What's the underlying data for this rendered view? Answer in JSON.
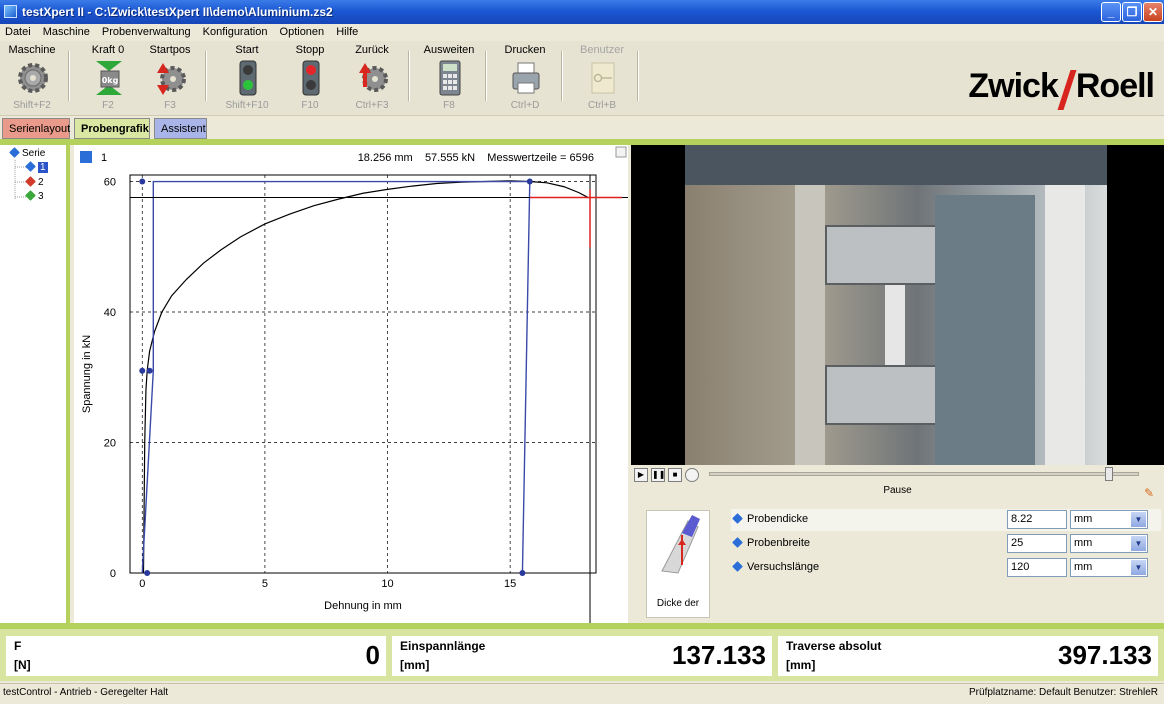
{
  "window": {
    "title": "testXpert II - C:\\Zwick\\testXpert II\\demo\\Aluminium.zs2",
    "controls": [
      "_",
      "❐",
      "✕"
    ]
  },
  "menu": [
    "Datei",
    "Maschine",
    "Probenverwaltung",
    "Konfiguration",
    "Optionen",
    "Hilfe"
  ],
  "toolbar": {
    "buttons": [
      {
        "label": "Maschine",
        "shortcut": "Shift+F2",
        "icon": "gear-icon"
      },
      {
        "label": "Kraft 0",
        "shortcut": "F2",
        "icon": "force-zero-icon"
      },
      {
        "label": "Startpos",
        "shortcut": "F3",
        "icon": "start-position-icon"
      },
      {
        "label": "Start",
        "shortcut": "Shift+F10",
        "icon": "traffic-light-green-icon"
      },
      {
        "label": "Stopp",
        "shortcut": "F10",
        "icon": "traffic-light-red-icon"
      },
      {
        "label": "Zurück",
        "shortcut": "Ctrl+F3",
        "icon": "return-icon"
      },
      {
        "label": "Ausweiten",
        "shortcut": "F8",
        "icon": "calculator-icon"
      },
      {
        "label": "Drucken",
        "shortcut": "Ctrl+D",
        "icon": "printer-icon"
      },
      {
        "label": "Benutzer",
        "shortcut": "Ctrl+B",
        "icon": "user-key-icon"
      }
    ],
    "logo": {
      "left": "Zwick",
      "right": "Roell"
    }
  },
  "tabs": [
    "Serienlayout",
    "Probengrafik",
    "Assistent"
  ],
  "tree": {
    "root": "Serie",
    "items": [
      {
        "label": "1",
        "color": "#2c6ed8"
      },
      {
        "label": "2",
        "color": "#d23a2a"
      },
      {
        "label": "3",
        "color": "#3aa83a"
      }
    ]
  },
  "chart_header": {
    "specimen": "1",
    "readout": "18.256 mm    57.555 kN    Messwertzeile = 6596"
  },
  "chart_data": {
    "type": "line",
    "xlabel": "Dehnung in mm",
    "ylabel": "Spannung in kN",
    "xlim": [
      -0.5,
      18.5
    ],
    "ylim": [
      0,
      61
    ],
    "xticks": [
      0,
      5,
      10,
      15
    ],
    "yticks": [
      0,
      20,
      40,
      60
    ],
    "grid": "dashed",
    "series": [
      {
        "color": "#000000",
        "x": [
          0.05,
          0.1,
          0.15,
          0.2,
          0.3,
          0.5,
          0.8,
          1.2,
          1.8,
          2.5,
          3.2,
          4.0,
          5.0,
          6.0,
          7.0,
          8.0,
          9.0,
          10.0,
          11.0,
          12.0,
          13.0,
          14.0,
          15.0,
          15.8,
          16.5,
          17.2,
          17.8,
          18.2
        ],
        "y": [
          0,
          20,
          28,
          31,
          34,
          37,
          40,
          42.5,
          45,
          47.5,
          49.5,
          51.5,
          53.5,
          55,
          56.3,
          57.3,
          58.2,
          58.8,
          59.3,
          59.7,
          59.9,
          60.0,
          60.1,
          60.0,
          59.8,
          59.2,
          58.3,
          57.5
        ]
      },
      {
        "color": "#3a4aa8",
        "x": [
          0,
          0.45,
          0.45,
          15.8,
          15.8,
          15.5
        ],
        "y": [
          0,
          31,
          60,
          60,
          60,
          0
        ]
      }
    ],
    "markers": [
      {
        "x": 0,
        "y": 60
      },
      {
        "x": 0,
        "y": 31
      },
      {
        "x": 0.3,
        "y": 31
      },
      {
        "x": 15.8,
        "y": 60
      },
      {
        "x": 15.5,
        "y": 0
      },
      {
        "x": 0.2,
        "y": 0
      }
    ],
    "crosshair": {
      "x": 18.256,
      "y": 57.555
    }
  },
  "video": {
    "status": "Pause",
    "progress": 0.94,
    "controls": [
      "play",
      "pause",
      "stop",
      "record"
    ]
  },
  "params": {
    "image_caption": "Dicke der",
    "rows": [
      {
        "label": "Probendicke",
        "value": "8.22",
        "unit": "mm"
      },
      {
        "label": "Probenbreite",
        "value": "25",
        "unit": "mm"
      },
      {
        "label": "Versuchslänge",
        "value": "120",
        "unit": "mm"
      }
    ]
  },
  "readouts": [
    {
      "name": "F",
      "unit": "[N]",
      "value": "0"
    },
    {
      "name": "Einspannlänge",
      "unit": "[mm]",
      "value": "137.133"
    },
    {
      "name": "Traverse absolut",
      "unit": "[mm]",
      "value": "397.133"
    }
  ],
  "status": {
    "left": "testControl - Antrieb - Geregelter Halt",
    "right": "Prüfplatzname: Default   Benutzer: StrehleR"
  }
}
